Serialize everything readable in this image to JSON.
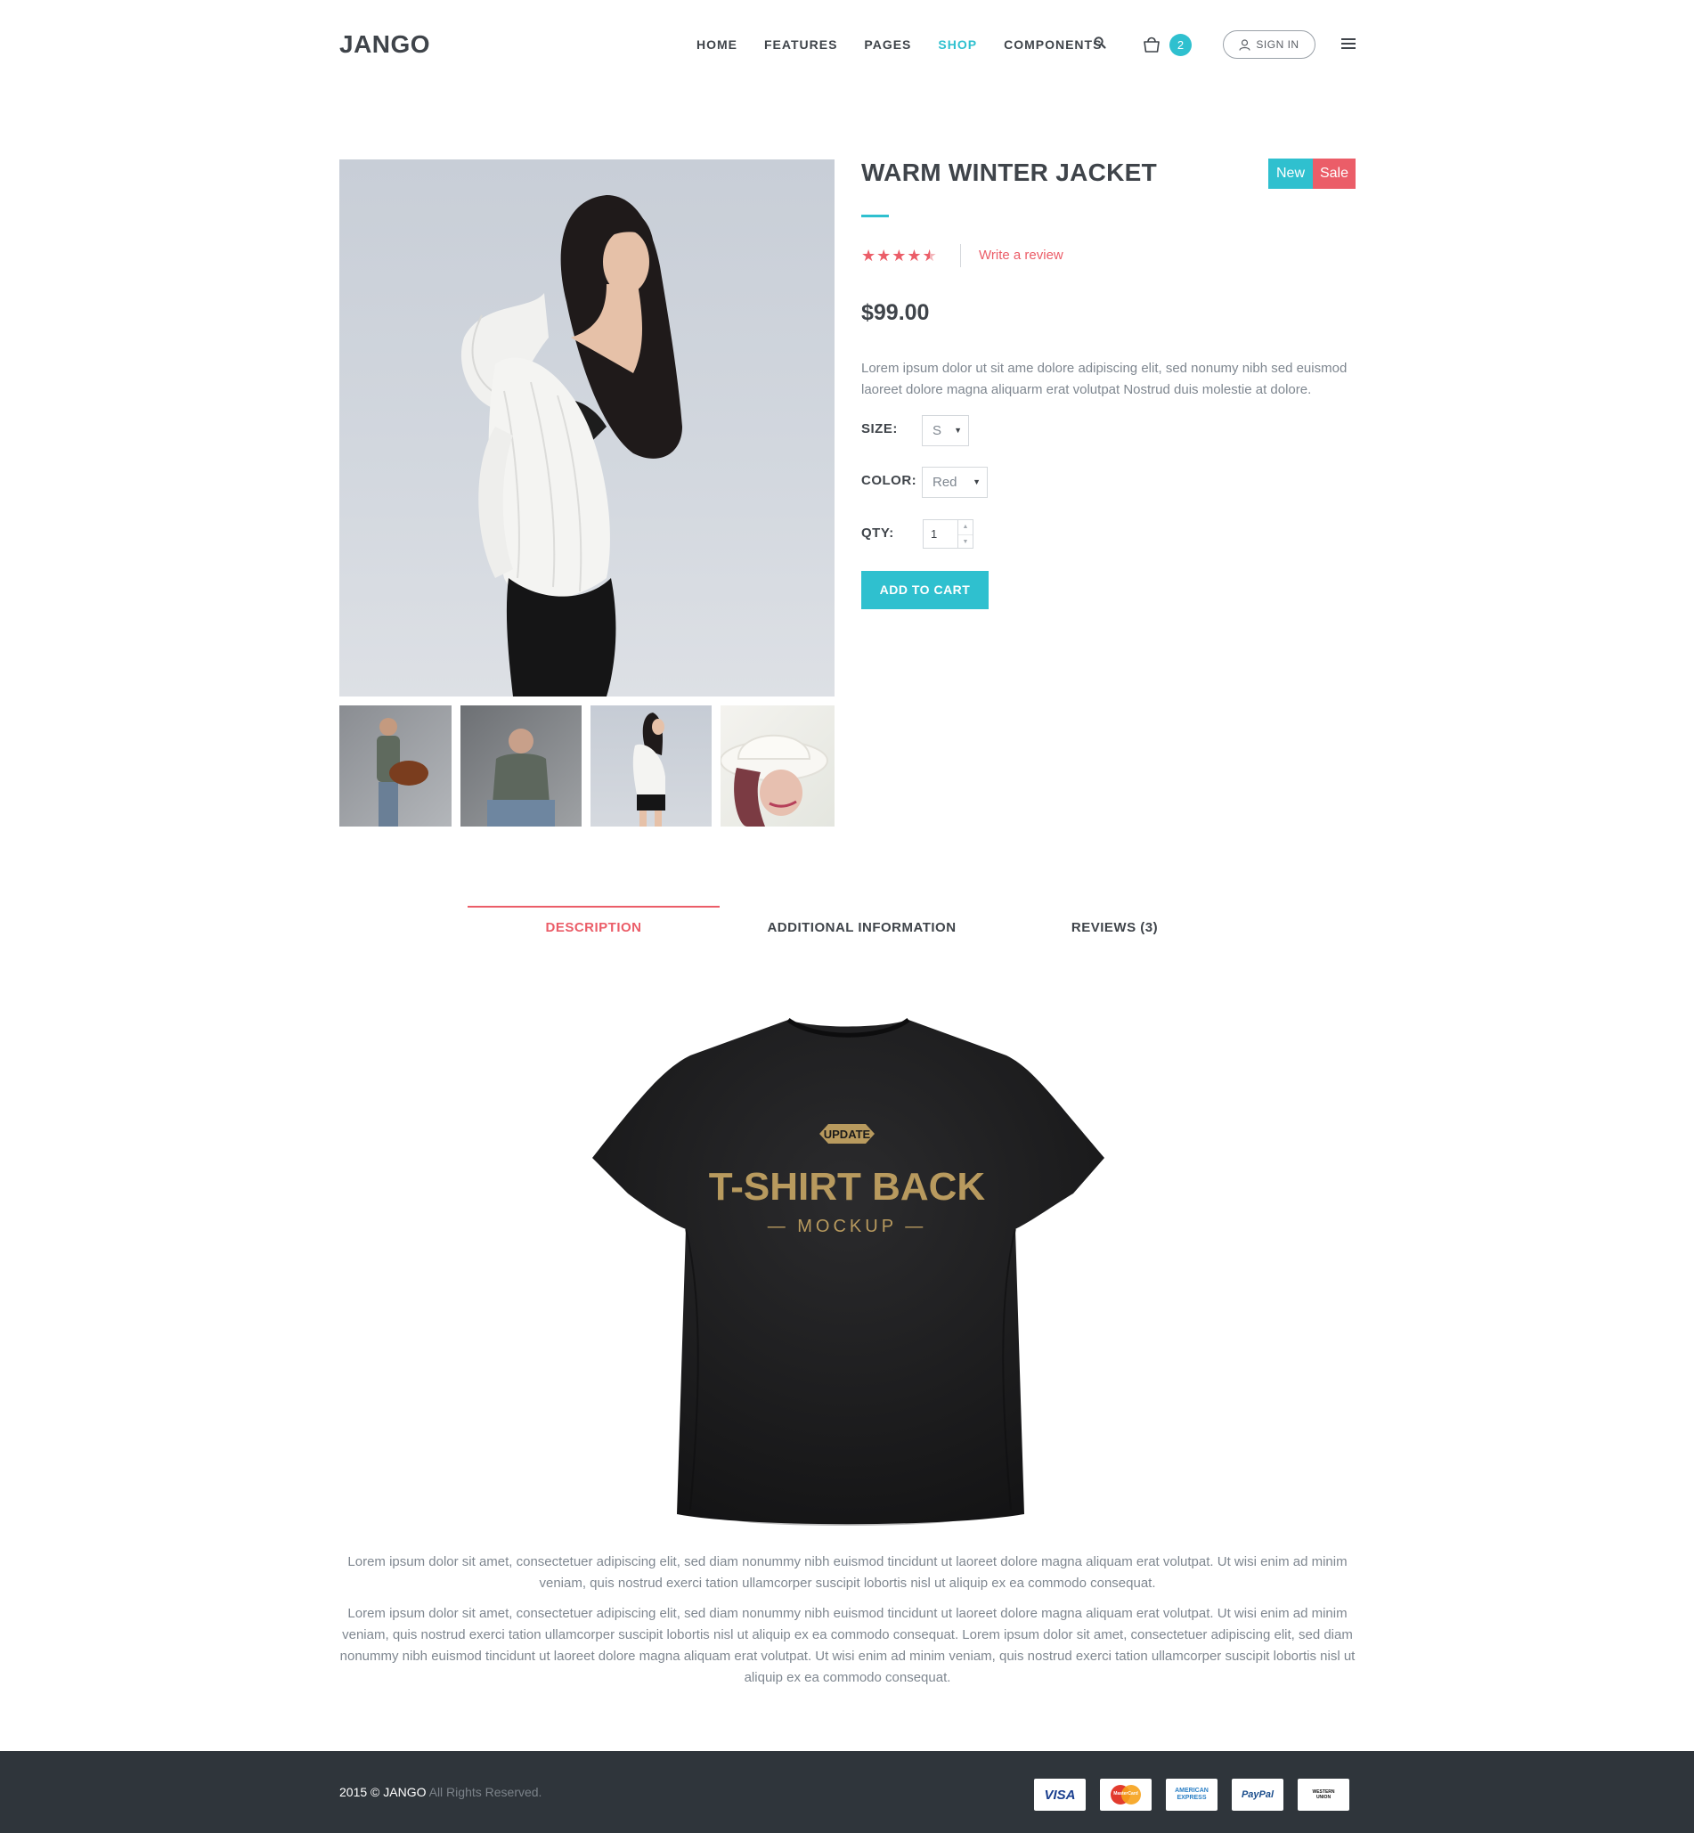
{
  "header": {
    "logo": "JANGO",
    "nav": [
      "HOME",
      "FEATURES",
      "PAGES",
      "SHOP",
      "COMPONENTS"
    ],
    "nav_active": "SHOP",
    "cart_count": "2",
    "signin_label": "SIGN IN"
  },
  "product": {
    "title": "WARM WINTER JACKET",
    "badge_new": "New",
    "badge_sale": "Sale",
    "rating": 4.5,
    "rating_max": 5,
    "review_link": "Write a review",
    "price": "$99.00",
    "description": "Lorem ipsum dolor ut sit ame dolore adipiscing elit, sed nonumy nibh sed euismod laoreet dolore magna aliquarm erat volutpat Nostrud duis molestie at dolore.",
    "size_label": "SIZE:",
    "size_value": "S",
    "color_label": "COLOR:",
    "color_value": "Red",
    "qty_label": "QTY:",
    "qty_value": "1",
    "add_to_cart": "ADD TO CART"
  },
  "tabs": [
    {
      "label": "DESCRIPTION",
      "active": true
    },
    {
      "label": "ADDITIONAL INFORMATION",
      "active": false
    },
    {
      "label": "REVIEWS (3)",
      "active": false
    }
  ],
  "tshirt_print": {
    "badge": "UPDATE",
    "title": "T-SHIRT BACK",
    "subtitle": "— MOCKUP —"
  },
  "description_paragraphs": [
    "Lorem ipsum dolor sit amet, consectetuer adipiscing elit, sed diam nonummy nibh euismod tincidunt ut laoreet dolore magna aliquam erat volutpat. Ut wisi enim ad minim veniam, quis nostrud exerci tation ullamcorper suscipit lobortis nisl ut aliquip ex ea commodo consequat.",
    "Lorem ipsum dolor sit amet, consectetuer adipiscing elit, sed diam nonummy nibh euismod tincidunt ut laoreet dolore magna aliquam erat volutpat. Ut wisi enim ad minim veniam, quis nostrud exerci tation ullamcorper suscipit lobortis nisl ut aliquip ex ea commodo consequat. Lorem ipsum dolor sit amet, consectetuer adipiscing elit, sed diam nonummy nibh euismod tincidunt ut laoreet dolore magna aliquam erat volutpat. Ut wisi enim ad minim veniam, quis nostrud exerci tation ullamcorper suscipit lobortis nisl ut aliquip ex ea commodo consequat."
  ],
  "footer": {
    "year": "2015 ©",
    "brand": "JANGO",
    "rights": "All Rights Reserved.",
    "payments": [
      "VISA",
      "MasterCard",
      "AMERICAN EXPRESS",
      "PayPal",
      "WESTERN UNION"
    ]
  },
  "colors": {
    "accent": "#2fc0cf",
    "sale": "#eb5d68",
    "text": "#3f444a",
    "muted": "#7f8790",
    "footer_bg": "#2f353b"
  },
  "icons": [
    "search-icon",
    "cart-icon",
    "user-icon",
    "menu-icon",
    "star-icon"
  ]
}
